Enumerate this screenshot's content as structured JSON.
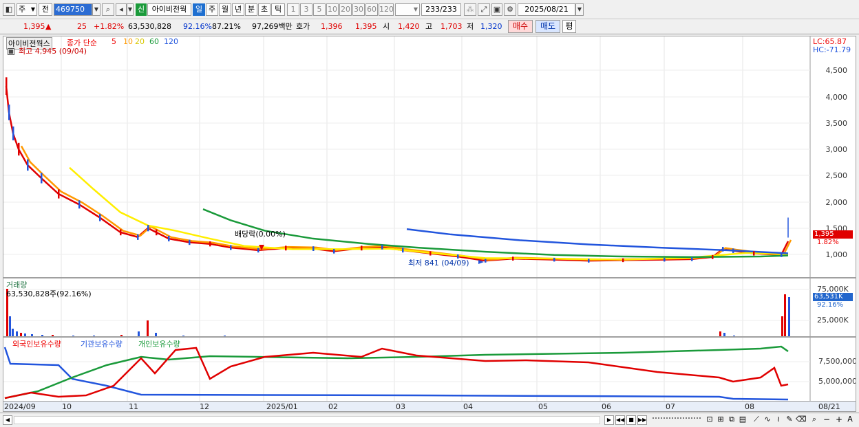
{
  "toolbar": {
    "period_main": "주",
    "prev_label": "전",
    "code": "469750",
    "badge_new": "신",
    "stock_name": "아이비전웍",
    "tabs": [
      "일",
      "주",
      "월",
      "년",
      "분",
      "초",
      "틱"
    ],
    "selected_tab": "일",
    "intervals": [
      "1",
      "3",
      "5",
      "10",
      "20",
      "30",
      "60",
      "120"
    ],
    "page_count": "233/233",
    "date": "2025/08/21"
  },
  "quote": {
    "price": "1,395",
    "change_arrow": "▲",
    "change": "25",
    "change_pct": "+1.82%",
    "volume": "63,530,828",
    "volume_pct": "92.16%",
    "rate2": "87.21%",
    "amount": "97,269백만",
    "hoga_label": "호가",
    "ask": "1,396",
    "bid": "1,395",
    "open_label": "시",
    "open": "1,420",
    "high_label": "고",
    "high": "1,703",
    "low_label": "저",
    "low": "1,320",
    "buy_label": "매수",
    "sell_label": "매도",
    "eval_label": "평"
  },
  "price_panel": {
    "title": "아이비전웍스",
    "indicator_label": "종가 단순",
    "ma_periods": [
      "5",
      "10",
      "20",
      "60",
      "120"
    ],
    "ma_colors": [
      "#e00000",
      "#ff9900",
      "#ffee00",
      "#1a9a3a",
      "#2255dd"
    ],
    "high_note": "최고 4,945 (09/04)",
    "low_note": "최저 841 (04/09)",
    "dividend_note": "배당락(0.00%)",
    "lc": "LC:65.87",
    "hc": "HC:-71.79",
    "ticks": [
      "4,500",
      "4,000",
      "3,500",
      "3,000",
      "2,500",
      "2,000",
      "1,500",
      "1,000"
    ],
    "current_price_box": "1,395",
    "current_pct": "1.82%"
  },
  "volume_panel": {
    "title": "거래량",
    "value_note": "63,530,828주(92.16%)",
    "ticks": [
      "75,000K",
      "25,000K"
    ],
    "current_box": "63,531K",
    "current_pct": "92.16%"
  },
  "holdings_panel": {
    "series": [
      "외국인보유수량",
      "기관보유수량",
      "개인보유수량"
    ],
    "series_colors": [
      "#e00000",
      "#2255dd",
      "#1a9a3a"
    ],
    "ticks": [
      "7,500,000",
      "5,000,000"
    ]
  },
  "dates": [
    "2024/09",
    "10",
    "11",
    "12",
    "2025/01",
    "02",
    "03",
    "04",
    "05",
    "06",
    "07",
    "08",
    "08/21"
  ]
}
